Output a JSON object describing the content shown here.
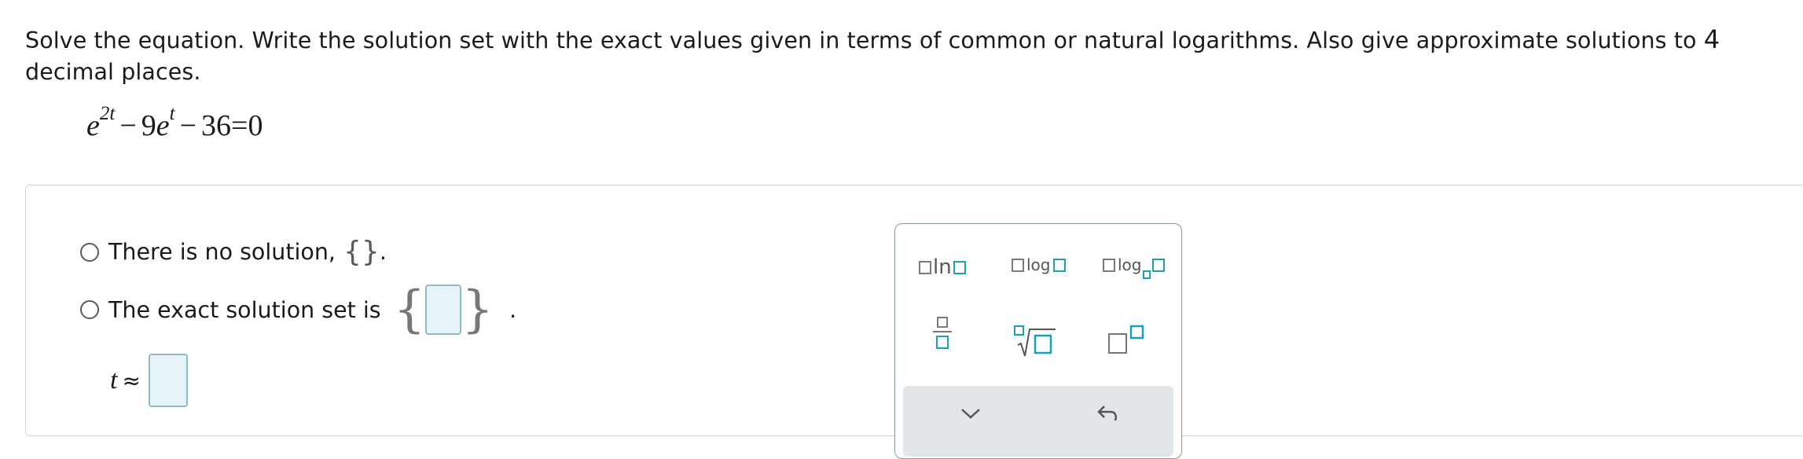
{
  "question": {
    "text_before": "Solve the equation. Write the solution set with the exact values given in terms of common or natural logarithms. Also give approximate solutions to ",
    "digits": "4",
    "text_after": " decimal places."
  },
  "equation": {
    "base1": "e",
    "exp1": "2t",
    "minus1": "−",
    "coef": "9",
    "base2": "e",
    "exp2": "t",
    "minus2": "−",
    "const": "36",
    "equals": "=",
    "rhs": "0"
  },
  "choices": {
    "no_solution": {
      "label": "There is no solution,",
      "empty_set": "{}",
      "period": "."
    },
    "exact_set": {
      "label": "The exact solution set is",
      "left_brace": "{",
      "right_brace": "}",
      "period": "."
    }
  },
  "approx_row": {
    "variable": "t",
    "symbol": "≈"
  },
  "palette": {
    "ln_label": "ln",
    "log_label": "log",
    "log_base_label": "log"
  },
  "colors": {
    "accent": "#1aa0b3",
    "input_bg": "#e6f4f8",
    "border": "#cfd4d8"
  }
}
